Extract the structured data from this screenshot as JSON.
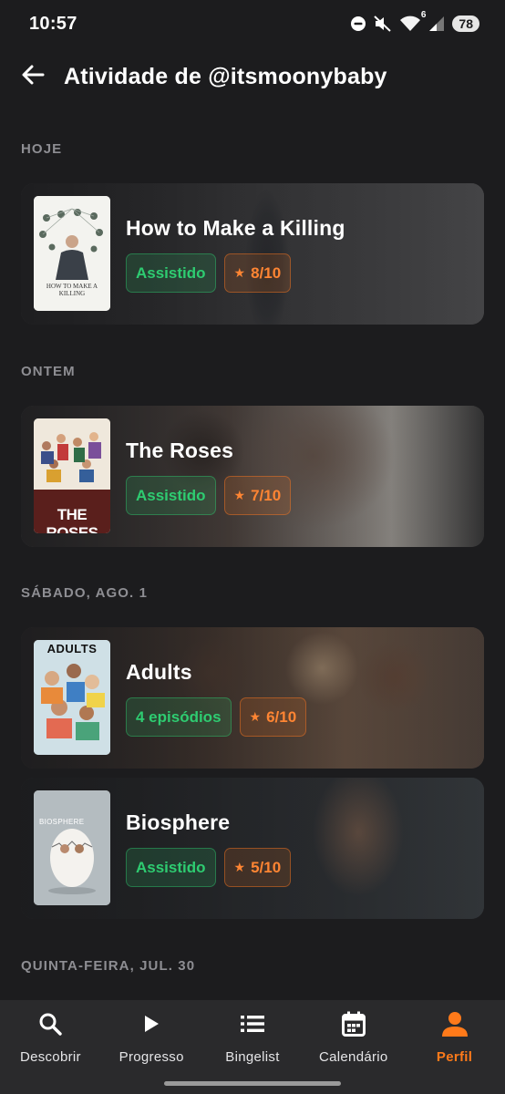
{
  "status_bar": {
    "time": "10:57",
    "battery": "78",
    "wifi_badge": "6",
    "icons": [
      "dnd-icon",
      "mute-icon",
      "wifi-icon",
      "signal-icon",
      "battery-icon"
    ]
  },
  "header": {
    "back_icon": "arrow-left-icon",
    "title": "Atividade de @itsmoonybaby"
  },
  "sections": [
    {
      "label": "HOJE",
      "items": [
        {
          "title": "How to Make a Killing",
          "status": "Assistido",
          "rating": "8/10",
          "poster_text": "HOW TO MAKE A KILLING"
        }
      ]
    },
    {
      "label": "ONTEM",
      "items": [
        {
          "title": "The Roses",
          "status": "Assistido",
          "rating": "7/10",
          "poster_text": "THE ROSES"
        }
      ]
    },
    {
      "label": "SÁBADO, AGO. 1",
      "items": [
        {
          "title": "Adults",
          "status": "4 episódios",
          "rating": "6/10",
          "poster_text": "ADULTS"
        },
        {
          "title": "Biosphere",
          "status": "Assistido",
          "rating": "5/10",
          "poster_text": "BIOSPHERE"
        }
      ]
    },
    {
      "label": "QUINTA-FEIRA, JUL. 30",
      "items": []
    }
  ],
  "bottom_nav": [
    {
      "label": "Descobrir",
      "icon": "search-icon",
      "active": false
    },
    {
      "label": "Progresso",
      "icon": "play-icon",
      "active": false
    },
    {
      "label": "Bingelist",
      "icon": "list-icon",
      "active": false
    },
    {
      "label": "Calendário",
      "icon": "calendar-icon",
      "active": false
    },
    {
      "label": "Perfil",
      "icon": "person-icon",
      "active": true
    }
  ],
  "colors": {
    "background": "#1c1c1e",
    "watched_green": "#2ecc71",
    "rating_orange": "#ff8533",
    "active_tab": "#ff7a1a"
  }
}
